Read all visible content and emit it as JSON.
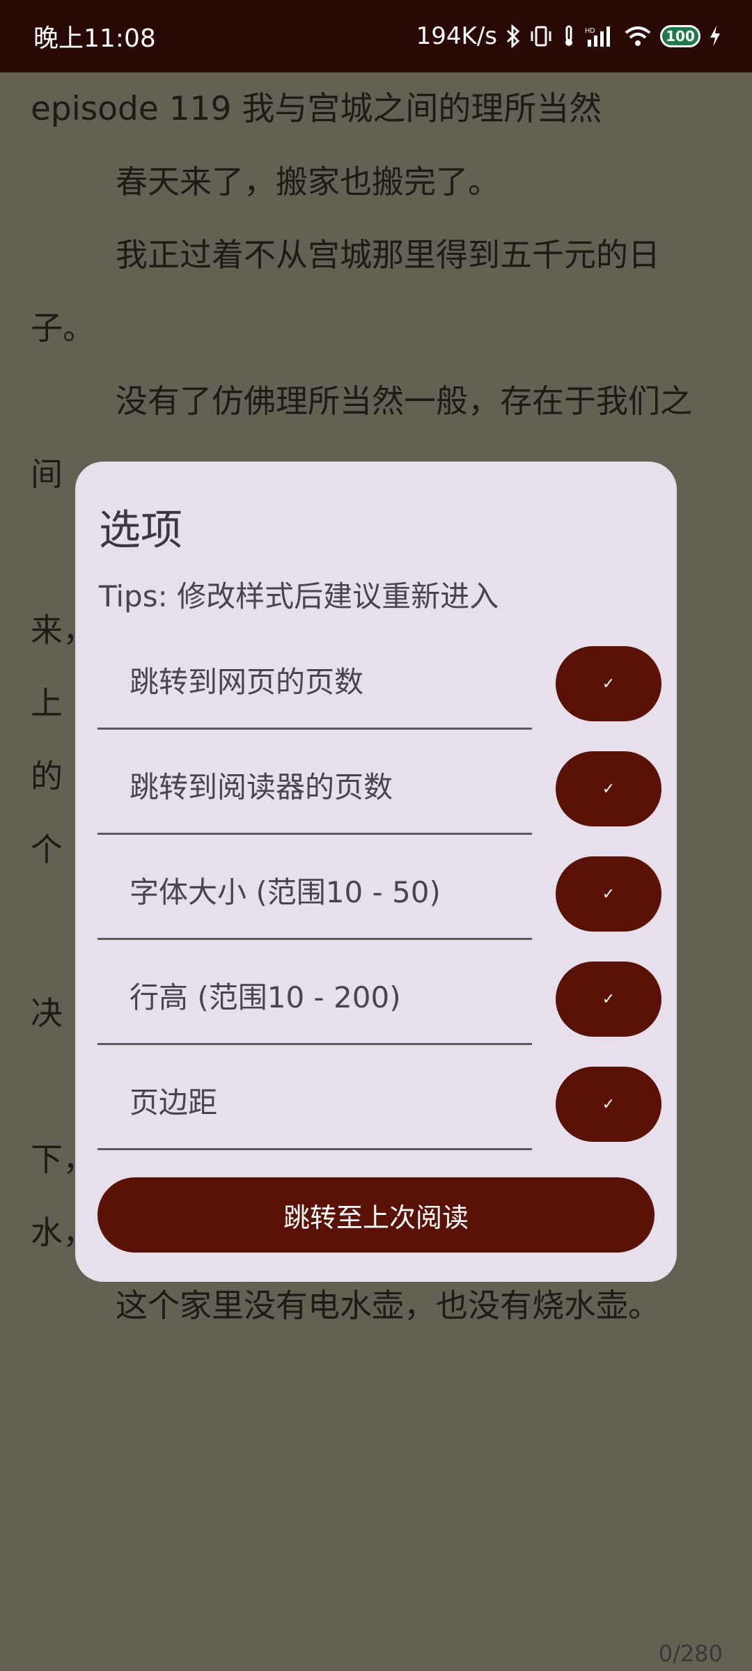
{
  "status_bar": {
    "time": "晚上11:08",
    "net_speed": "194K/s",
    "battery": "100",
    "icons": [
      "bluetooth-icon",
      "vibrate-icon",
      "location-icon",
      "signal-icon",
      "wifi-icon",
      "battery-icon",
      "charging-icon"
    ]
  },
  "reader": {
    "title": "episode 119 我与宫城之间的理所当然",
    "paragraphs": [
      "春天来了，搬家也搬完了。",
      "我正过着不从宫城那里得到五千元的日子。",
      "没有了仿佛理所当然一般，存在于我们之间",
      "来，",
      "上",
      "的",
      "个",
      "决",
      "下，",
      "水，",
      "这个家里没有电水壶，也没有烧水壶。"
    ],
    "page_counter": "0/280"
  },
  "dialog": {
    "title": "选项",
    "tips": "Tips: 修改样式后建议重新进入",
    "fields": [
      {
        "label": "跳转到网页的页数"
      },
      {
        "label": "跳转到阅读器的页数"
      },
      {
        "label": "字体大小 (范围10 - 50)"
      },
      {
        "label": "行高 (范围10 - 200)"
      },
      {
        "label": "页边距"
      }
    ],
    "check_glyph": "✓",
    "jump_button": "跳转至上次阅读"
  },
  "colors": {
    "status_bar_bg": "#2a0806",
    "page_bg": "#636153",
    "dialog_bg": "#e7dfeb",
    "accent": "#5b1206"
  }
}
